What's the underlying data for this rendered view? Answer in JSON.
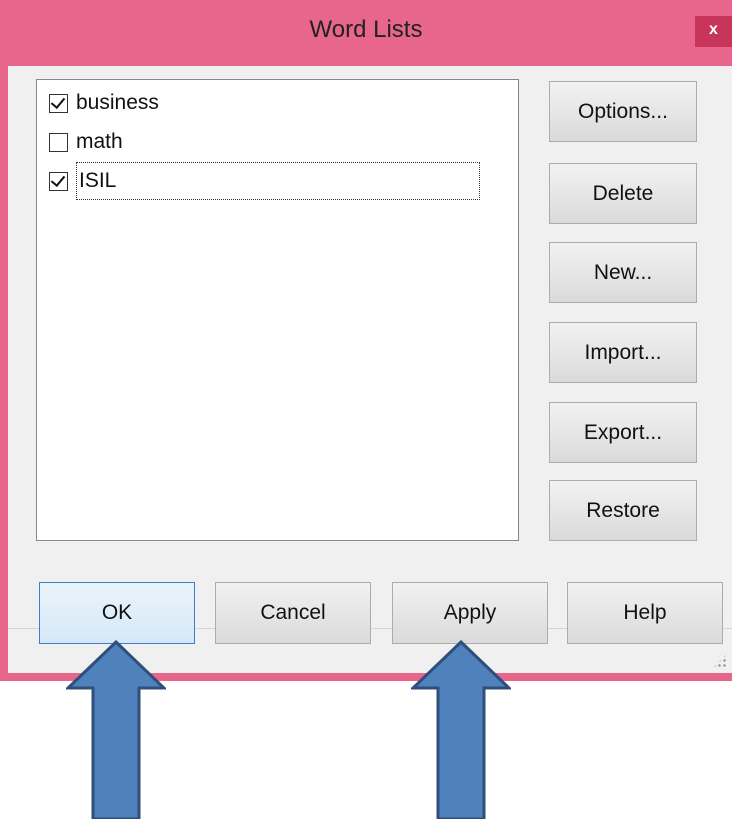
{
  "window": {
    "title": "Word Lists",
    "close_label": "x"
  },
  "word_list": {
    "items": [
      {
        "label": "business",
        "checked": true
      },
      {
        "label": "math",
        "checked": false
      },
      {
        "label": "ISIL",
        "checked": true
      }
    ]
  },
  "side_buttons": {
    "options": "Options...",
    "delete": "Delete",
    "new": "New...",
    "import": "Import...",
    "export": "Export...",
    "restore": "Restore"
  },
  "bottom_buttons": {
    "ok": "OK",
    "cancel": "Cancel",
    "apply": "Apply",
    "help": "Help"
  },
  "colors": {
    "title_bar": "#e8658c",
    "arrow_fill": "#4f81bd",
    "arrow_stroke": "#2f4f7a"
  },
  "annotations": {
    "arrow_icons": [
      "up-arrow-icon",
      "up-arrow-icon"
    ]
  }
}
